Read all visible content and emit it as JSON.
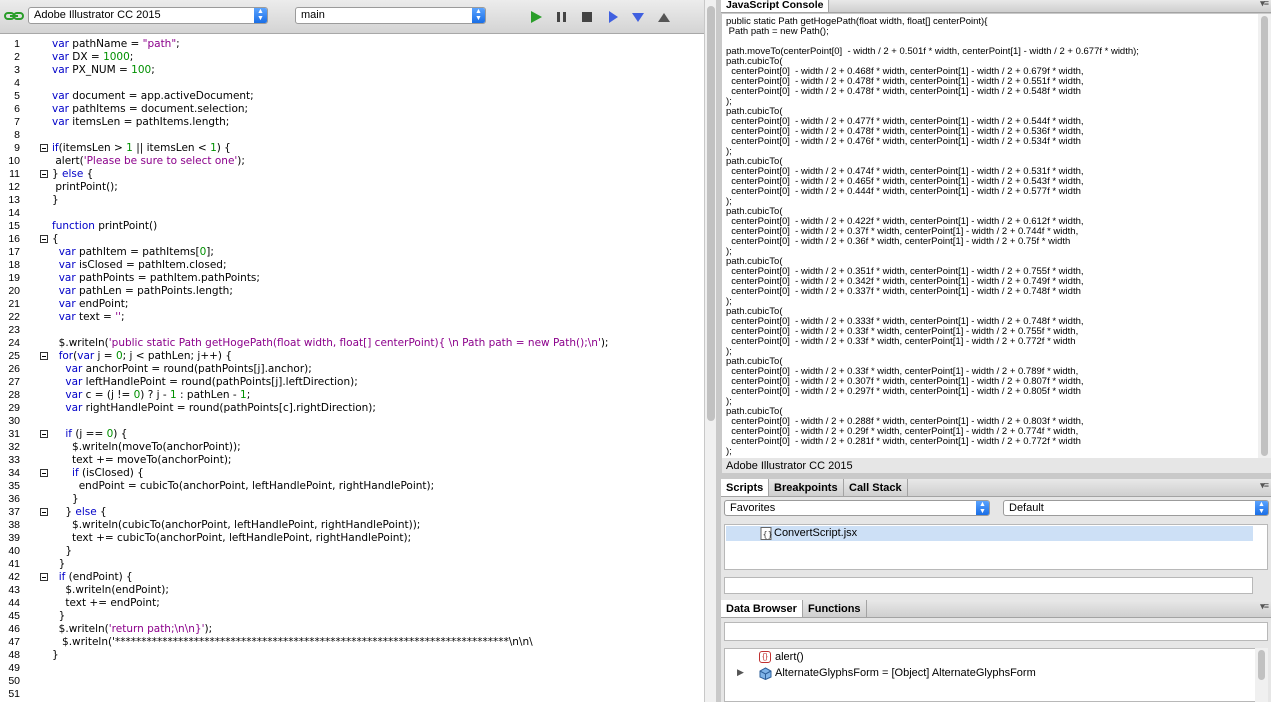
{
  "toolbar": {
    "target_app": "Adobe Illustrator CC 2015",
    "target_engine": "main",
    "colors": {
      "run": "#2a9d2a",
      "step": "#4060e0"
    }
  },
  "editor": {
    "lines": [
      {
        "n": "1",
        "code": "var pathName = \"path\";"
      },
      {
        "n": "2",
        "code": "var DX = 1000;"
      },
      {
        "n": "3",
        "code": "var PX_NUM = 100;"
      },
      {
        "n": "4",
        "code": ""
      },
      {
        "n": "5",
        "code": "var document = app.activeDocument;"
      },
      {
        "n": "6",
        "code": "var pathItems = document.selection;"
      },
      {
        "n": "7",
        "code": "var itemsLen = pathItems.length;"
      },
      {
        "n": "8",
        "code": ""
      },
      {
        "n": "9",
        "code": "if(itemsLen > 1 || itemsLen < 1) {"
      },
      {
        "n": "10",
        "code": " alert('Please be sure to select one');"
      },
      {
        "n": "11",
        "code": "} else {"
      },
      {
        "n": "12",
        "code": " printPoint();"
      },
      {
        "n": "13",
        "code": "}"
      },
      {
        "n": "14",
        "code": ""
      },
      {
        "n": "15",
        "code": "function printPoint()"
      },
      {
        "n": "16",
        "code": "{"
      },
      {
        "n": "17",
        "code": "  var pathItem = pathItems[0];"
      },
      {
        "n": "18",
        "code": "  var isClosed = pathItem.closed;"
      },
      {
        "n": "19",
        "code": "  var pathPoints = pathItem.pathPoints;"
      },
      {
        "n": "20",
        "code": "  var pathLen = pathPoints.length;"
      },
      {
        "n": "21",
        "code": "  var endPoint;"
      },
      {
        "n": "22",
        "code": "  var text = '';"
      },
      {
        "n": "23",
        "code": ""
      },
      {
        "n": "24",
        "code": "  $.writeln('public static Path getHogePath(float width, float[] centerPoint){ \\n Path path = new Path();\\n');"
      },
      {
        "n": "25",
        "code": "  for(var j = 0; j < pathLen; j++) {"
      },
      {
        "n": "26",
        "code": "    var anchorPoint = round(pathPoints[j].anchor);"
      },
      {
        "n": "27",
        "code": "    var leftHandlePoint = round(pathPoints[j].leftDirection);"
      },
      {
        "n": "28",
        "code": "    var c = (j != 0) ? j - 1 : pathLen - 1;"
      },
      {
        "n": "29",
        "code": "    var rightHandlePoint = round(pathPoints[c].rightDirection);"
      },
      {
        "n": "30",
        "code": ""
      },
      {
        "n": "31",
        "code": "    if (j == 0) {"
      },
      {
        "n": "32",
        "code": "      $.writeln(moveTo(anchorPoint));"
      },
      {
        "n": "33",
        "code": "      text += moveTo(anchorPoint);"
      },
      {
        "n": "34",
        "code": "      if (isClosed) {"
      },
      {
        "n": "35",
        "code": "        endPoint = cubicTo(anchorPoint, leftHandlePoint, rightHandlePoint);"
      },
      {
        "n": "36",
        "code": "      }"
      },
      {
        "n": "37",
        "code": "    } else {"
      },
      {
        "n": "38",
        "code": "      $.writeln(cubicTo(anchorPoint, leftHandlePoint, rightHandlePoint));"
      },
      {
        "n": "39",
        "code": "      text += cubicTo(anchorPoint, leftHandlePoint, rightHandlePoint);"
      },
      {
        "n": "40",
        "code": "    }"
      },
      {
        "n": "41",
        "code": "  }"
      },
      {
        "n": "42",
        "code": "  if (endPoint) {"
      },
      {
        "n": "43",
        "code": "    $.writeln(endPoint);"
      },
      {
        "n": "44",
        "code": "    text += endPoint;"
      },
      {
        "n": "45",
        "code": "  }"
      },
      {
        "n": "46",
        "code": "  $.writeln('return path;\\n\\n}');"
      },
      {
        "n": "47",
        "code": "   $.writeln('***************************************************************************\\n\\n\\"
      },
      {
        "n": "48",
        "code": "}"
      },
      {
        "n": "49",
        "code": ""
      },
      {
        "n": "50",
        "code": ""
      },
      {
        "n": "51",
        "code": ""
      }
    ]
  },
  "console": {
    "title": "JavaScript Console",
    "status": "Adobe Illustrator CC 2015",
    "lines": [
      "public static Path getHogePath(float width, float[] centerPoint){",
      " Path path = new Path();",
      "",
      "path.moveTo(centerPoint[0]  - width / 2 + 0.501f * width, centerPoint[1] - width / 2 + 0.677f * width);",
      "path.cubicTo(",
      "  centerPoint[0]  - width / 2 + 0.468f * width, centerPoint[1] - width / 2 + 0.679f * width,",
      "  centerPoint[0]  - width / 2 + 0.478f * width, centerPoint[1] - width / 2 + 0.551f * width,",
      "  centerPoint[0]  - width / 2 + 0.478f * width, centerPoint[1] - width / 2 + 0.548f * width",
      ");",
      "path.cubicTo(",
      "  centerPoint[0]  - width / 2 + 0.477f * width, centerPoint[1] - width / 2 + 0.544f * width,",
      "  centerPoint[0]  - width / 2 + 0.478f * width, centerPoint[1] - width / 2 + 0.536f * width,",
      "  centerPoint[0]  - width / 2 + 0.476f * width, centerPoint[1] - width / 2 + 0.534f * width",
      ");",
      "path.cubicTo(",
      "  centerPoint[0]  - width / 2 + 0.474f * width, centerPoint[1] - width / 2 + 0.531f * width,",
      "  centerPoint[0]  - width / 2 + 0.465f * width, centerPoint[1] - width / 2 + 0.543f * width,",
      "  centerPoint[0]  - width / 2 + 0.444f * width, centerPoint[1] - width / 2 + 0.577f * width",
      ");",
      "path.cubicTo(",
      "  centerPoint[0]  - width / 2 + 0.422f * width, centerPoint[1] - width / 2 + 0.612f * width,",
      "  centerPoint[0]  - width / 2 + 0.37f * width, centerPoint[1] - width / 2 + 0.744f * width,",
      "  centerPoint[0]  - width / 2 + 0.36f * width, centerPoint[1] - width / 2 + 0.75f * width",
      ");",
      "path.cubicTo(",
      "  centerPoint[0]  - width / 2 + 0.351f * width, centerPoint[1] - width / 2 + 0.755f * width,",
      "  centerPoint[0]  - width / 2 + 0.342f * width, centerPoint[1] - width / 2 + 0.749f * width,",
      "  centerPoint[0]  - width / 2 + 0.337f * width, centerPoint[1] - width / 2 + 0.748f * width",
      ");",
      "path.cubicTo(",
      "  centerPoint[0]  - width / 2 + 0.333f * width, centerPoint[1] - width / 2 + 0.748f * width,",
      "  centerPoint[0]  - width / 2 + 0.33f * width, centerPoint[1] - width / 2 + 0.755f * width,",
      "  centerPoint[0]  - width / 2 + 0.33f * width, centerPoint[1] - width / 2 + 0.772f * width",
      ");",
      "path.cubicTo(",
      "  centerPoint[0]  - width / 2 + 0.33f * width, centerPoint[1] - width / 2 + 0.789f * width,",
      "  centerPoint[0]  - width / 2 + 0.307f * width, centerPoint[1] - width / 2 + 0.807f * width,",
      "  centerPoint[0]  - width / 2 + 0.297f * width, centerPoint[1] - width / 2 + 0.805f * width",
      ");",
      "path.cubicTo(",
      "  centerPoint[0]  - width / 2 + 0.288f * width, centerPoint[1] - width / 2 + 0.803f * width,",
      "  centerPoint[0]  - width / 2 + 0.29f * width, centerPoint[1] - width / 2 + 0.774f * width,",
      "  centerPoint[0]  - width / 2 + 0.281f * width, centerPoint[1] - width / 2 + 0.772f * width",
      ");"
    ]
  },
  "scripts_panel": {
    "tabs": [
      "Scripts",
      "Breakpoints",
      "Call Stack"
    ],
    "location_select": "Favorites",
    "group_select": "Default",
    "items": [
      "ConvertScript.jsx"
    ]
  },
  "data_browser": {
    "tabs": [
      "Data Browser",
      "Functions"
    ],
    "items": [
      {
        "label": "alert()",
        "icon": "function-icon"
      },
      {
        "label": "AlternateGlyphsForm = [Object] AlternateGlyphsForm",
        "icon": "object-cube-icon"
      }
    ]
  }
}
